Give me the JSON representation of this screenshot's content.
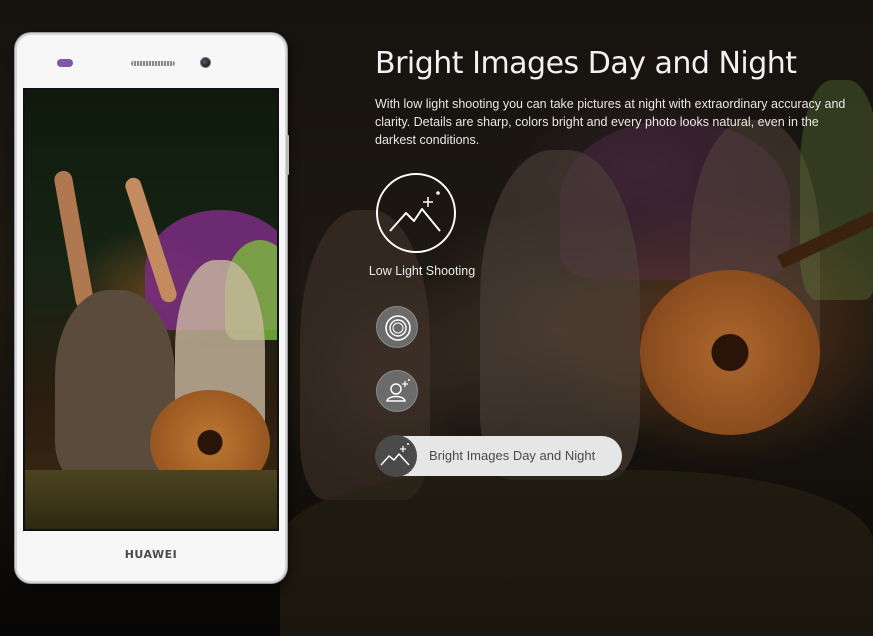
{
  "phone": {
    "brand": "HUAWEI"
  },
  "feature": {
    "title": "Bright Images Day and Night",
    "description": "With low light shooting you can take pictures at night with extraordinary accuracy and clarity. Details are sharp, colors bright and every photo looks natural, even in the darkest conditions."
  },
  "features": {
    "active_icon": "mountain-sparkle-icon",
    "active_label": "Low Light Shooting",
    "items": [
      {
        "icon": "aperture-icon"
      },
      {
        "icon": "portrait-sparkle-icon"
      },
      {
        "icon": "mountain-sparkle-icon",
        "label": "Bright Images Day and Night"
      }
    ]
  },
  "colors": {
    "pill_background": "#e6e6e6",
    "icon_circle_grey": "#6b6b6b",
    "led_purple": "#7a5aa8"
  }
}
